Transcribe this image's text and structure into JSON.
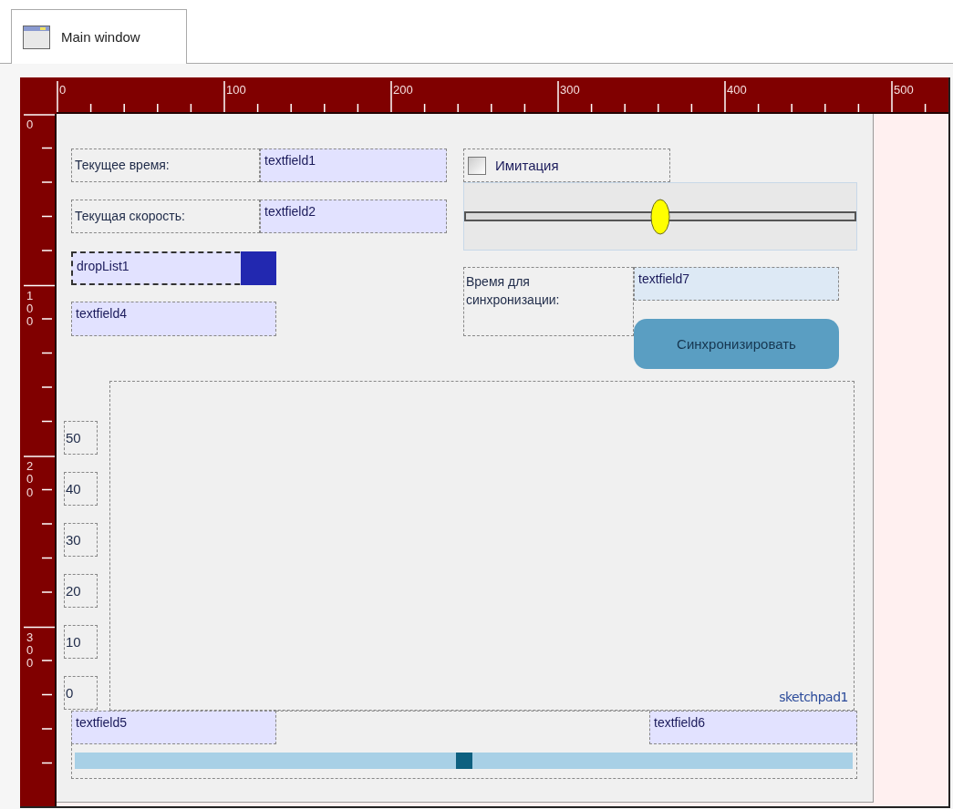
{
  "tabs": [
    {
      "label": "Main window",
      "selected": true
    }
  ],
  "ruler": {
    "top_labels": [
      "0",
      "100",
      "200",
      "300",
      "400",
      "500"
    ],
    "left_labels": [
      "0",
      "100",
      "200",
      "300"
    ]
  },
  "form": {
    "rows": [
      {
        "label": "Текущее время:",
        "field": "textfield1"
      },
      {
        "label": "Текущая скорость:",
        "field": "textfield2"
      }
    ],
    "dropdown": {
      "value": "dropList1"
    },
    "field_below_dropdown": {
      "value": "textfield4"
    },
    "option": {
      "label": "Имитация",
      "checked": false
    },
    "slider": {
      "level": 0.5
    },
    "sync": {
      "label": "Время для синхронизации:",
      "field": "textfield7",
      "button": "Синхронизировать"
    },
    "sketchpad": {
      "name": "sketchpad1",
      "axis_labels": [
        "50",
        "40",
        "30",
        "20",
        "10",
        "0"
      ]
    },
    "bottom_fields": [
      "textfield5",
      "textfield6"
    ],
    "bottom_slider": {
      "level": 0.5
    }
  }
}
